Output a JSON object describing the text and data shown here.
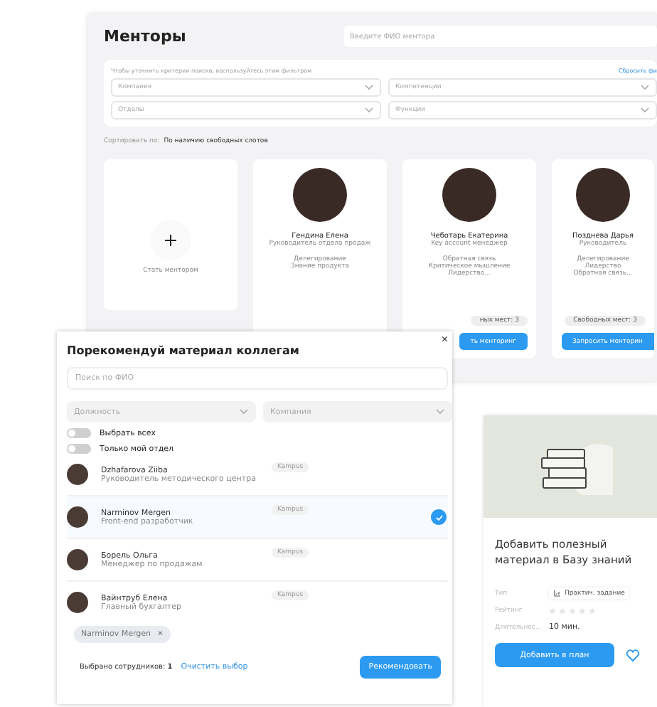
{
  "mentors_page": {
    "title": "Менторы",
    "search": {
      "placeholder": "Введите ФИО ментора"
    },
    "filters": {
      "hint": "Чтобы уточнить критерии поиска, воспользуйтесь этим фильтром",
      "reset_link": "Сбросить фи",
      "dropdowns": [
        {
          "placeholder": "Компания"
        },
        {
          "placeholder": "Компетенции"
        },
        {
          "placeholder": "Отделы"
        },
        {
          "placeholder": "Функции"
        }
      ]
    },
    "sort": {
      "label": "Сортировать по:",
      "value": "По наличию свободных слотов"
    },
    "become_mentor": "Стать ментором",
    "mentors": [
      {
        "name": "Гендина Елена",
        "position": "Руководитель отдела продаж",
        "skills": [
          "Делегирование",
          "Знание продукта"
        ]
      },
      {
        "name": "Чеботарь Екатерина",
        "position": "Key account менеджер",
        "skills": [
          "Обратная связь",
          "Критическое мышление",
          "Лидерство..."
        ],
        "slots": "ных мест: 3",
        "button": "ть менторинг"
      },
      {
        "name": "Позднева Дарья",
        "position": "Руководитель",
        "skills": [
          "Делегирование",
          "Лидерство",
          "Обратная связь..."
        ],
        "slots": "Свободных мест: 3",
        "button": "Запросить менторин"
      }
    ]
  },
  "modal": {
    "title": "Порекомендуй материал коллегам",
    "close": "×",
    "search": {
      "placeholder": "Поиск по ФИО"
    },
    "dropdowns": [
      {
        "placeholder": "Должность"
      },
      {
        "placeholder": "Компания"
      }
    ],
    "toggles": [
      {
        "label": "Выбрать всех",
        "on": false
      },
      {
        "label": "Только мой отдел",
        "on": false
      }
    ],
    "people": [
      {
        "name": "Dzhafarova Ziiba",
        "position": "Руководитель методического центра",
        "tag": "Kampus",
        "selected": false
      },
      {
        "name": "Narminov Mergen",
        "position": "Front-end разработчик",
        "tag": "Kampus",
        "selected": true
      },
      {
        "name": "Борель Ольга",
        "position": "Менеджер по продажам",
        "tag": "Kampus",
        "selected": false
      },
      {
        "name": "Вайнтруб Елена",
        "position": "Главный бухгалтер",
        "tag": "Kampus",
        "selected": false
      }
    ],
    "chips": [
      {
        "label": "Narminov Mergen",
        "remove": "×"
      }
    ],
    "selected_count": "Выбрано сотрудников: **1**",
    "clear_link": "Очистить выбор",
    "submit": "Рекомендовать"
  },
  "material": {
    "title": "Добавить полезный материал в Базу знаний",
    "type": {
      "label": "Тип",
      "value": "Практич. задание"
    },
    "rating": {
      "label": "Рейтинг",
      "stars": 0
    },
    "duration": {
      "label": "Длительнос...",
      "value": "10 мин."
    },
    "button": "Добавить в план"
  }
}
